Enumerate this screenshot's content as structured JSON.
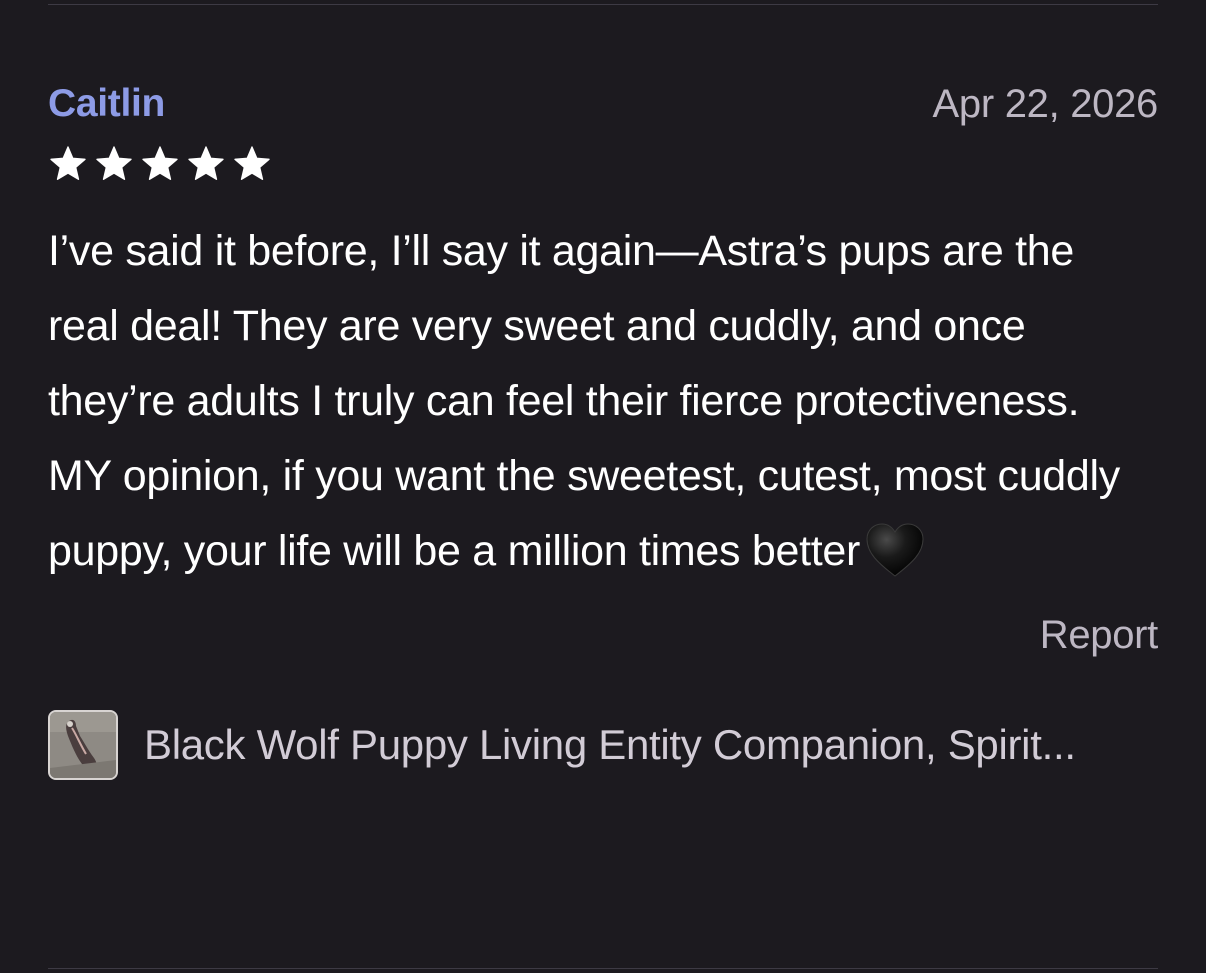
{
  "review": {
    "reviewer_name": "Caitlin",
    "date": "Apr 22, 2026",
    "rating": 5,
    "rating_max": 5,
    "body": "I’ve said it before, I’ll say it again—Astra’s pups are the real deal! They are very sweet and cuddly, and once they’re adults I truly can feel their fierce protectiveness. MY opinion, if you want the sweetest, cutest, most cuddly puppy, your life will be a million times better",
    "body_emoji": "black-heart-icon",
    "report_label": "Report",
    "product": {
      "title": "Black Wolf Puppy Living Entity Companion, Spirit...",
      "thumbnail_icon": "product-thumbnail"
    }
  },
  "colors": {
    "background": "#1c1a1f",
    "reviewer_name": "#8d9be6",
    "secondary_text": "#bdb7c3",
    "body_text": "#ffffff"
  }
}
